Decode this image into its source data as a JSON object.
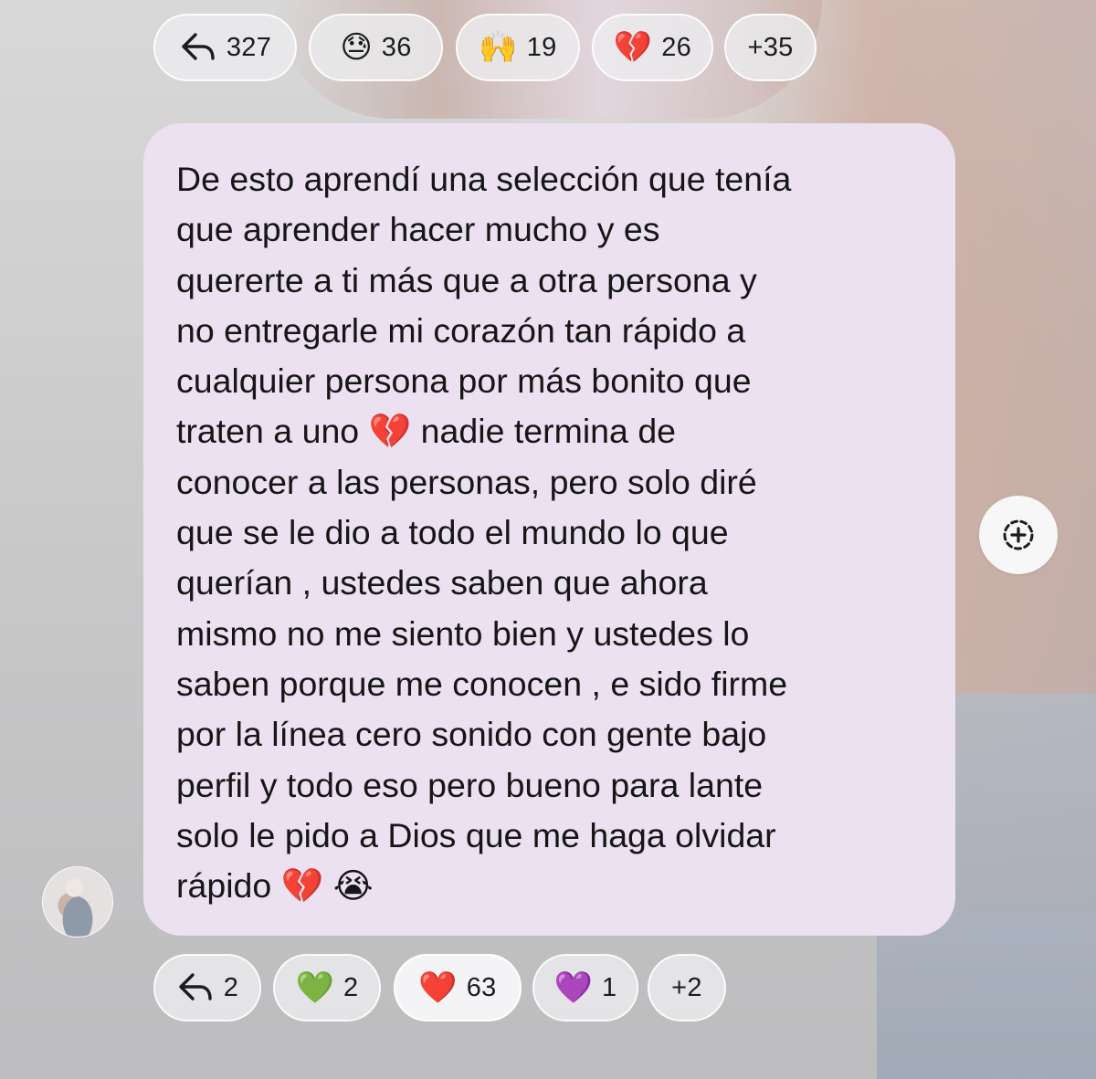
{
  "top_reactions": [
    {
      "type": "reply",
      "icon": "reply-arrow-icon",
      "count": "327"
    },
    {
      "type": "emoji",
      "emoji": "😓",
      "icon": "downcast-sweat-face-icon",
      "count": "36"
    },
    {
      "type": "emoji",
      "emoji": "🙌",
      "icon": "raised-hands-icon",
      "count": "19"
    },
    {
      "type": "emoji",
      "emoji": "💔",
      "icon": "broken-heart-icon",
      "count": "26"
    },
    {
      "type": "more",
      "count": "+35"
    }
  ],
  "message": {
    "lines": [
      "De esto aprendí una selección que tenía",
      "que aprender hacer mucho y es",
      "quererte a ti más que a otra persona y",
      "no entregarle mi corazón tan rápido a",
      "cualquier persona por más bonito que",
      "traten a uno 💔 nadie termina de",
      "conocer a las personas, pero solo diré",
      "que se le dio a todo el mundo lo que",
      "querían , ustedes saben que ahora",
      "mismo no me siento bien y ustedes lo",
      "saben porque me conocen , e sido firme",
      "por la línea cero sonido con gente bajo",
      "perfil y todo eso pero bueno para lante",
      "solo le pido a Dios que me haga olvidar",
      "rápido 💔 😭"
    ],
    "bubble_color": "#ebe1f1"
  },
  "add_reaction_icon": "add-reaction-icon",
  "bottom_reactions": [
    {
      "type": "reply",
      "icon": "reply-arrow-icon",
      "count": "2"
    },
    {
      "type": "emoji",
      "emoji": "💚",
      "icon": "green-heart-icon",
      "count": "2"
    },
    {
      "type": "emoji",
      "emoji": "❤️",
      "icon": "red-heart-icon",
      "count": "63",
      "selected": true
    },
    {
      "type": "emoji",
      "emoji": "💜",
      "icon": "purple-heart-icon",
      "count": "1"
    },
    {
      "type": "more",
      "count": "+2"
    }
  ]
}
